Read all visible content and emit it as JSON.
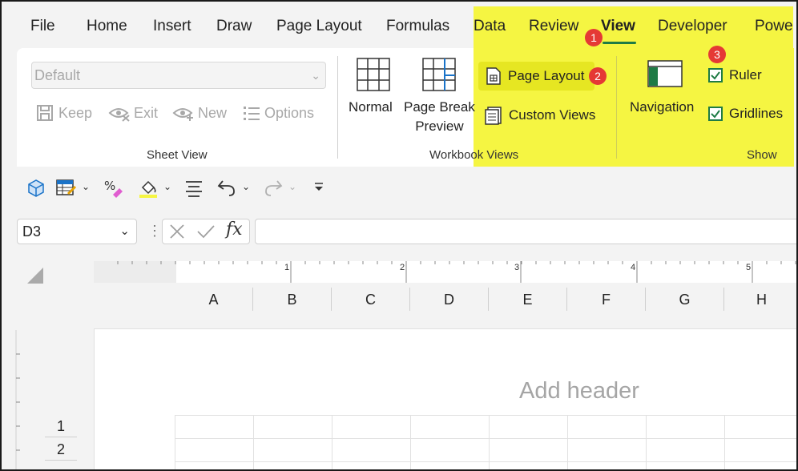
{
  "menu_tabs": {
    "file": "File",
    "home": "Home",
    "insert": "Insert",
    "draw": "Draw",
    "page_layout": "Page Layout",
    "formulas": "Formulas",
    "data": "Data",
    "review": "Review",
    "view": "View",
    "developer": "Developer",
    "power": "Powe"
  },
  "badges": {
    "one": "1",
    "two": "2",
    "three": "3"
  },
  "sheet_view": {
    "select_value": "Default",
    "keep": "Keep",
    "exit": "Exit",
    "new": "New",
    "options": "Options",
    "group_label": "Sheet View"
  },
  "workbook_views": {
    "normal": "Normal",
    "page_break_line1": "Page Break",
    "page_break_line2": "Preview",
    "page_layout": "Page Layout",
    "custom_views": "Custom Views",
    "group_label": "Workbook Views"
  },
  "show": {
    "navigation": "Navigation",
    "ruler": "Ruler",
    "ruler_checked": true,
    "gridlines": "Gridlines",
    "gridlines_checked": true,
    "group_label": "Show"
  },
  "name_box": {
    "value": "D3"
  },
  "formula_bar": {
    "fx": "fx",
    "value": ""
  },
  "ruler_numbers": [
    "1",
    "2",
    "3",
    "4",
    "5"
  ],
  "columns": [
    "A",
    "B",
    "C",
    "D",
    "E",
    "F",
    "G",
    "H"
  ],
  "rows": [
    "1",
    "2"
  ],
  "page": {
    "add_header": "Add header"
  },
  "colors": {
    "highlight": "#f5f542",
    "badge": "#e53935",
    "accent_green": "#1e7b45"
  },
  "icons": [
    "keep-icon",
    "exit-icon",
    "new-icon",
    "options-icon",
    "normal-view-icon",
    "page-break-preview-icon",
    "page-layout-icon",
    "custom-views-icon",
    "navigation-icon",
    "checkbox-icon"
  ]
}
